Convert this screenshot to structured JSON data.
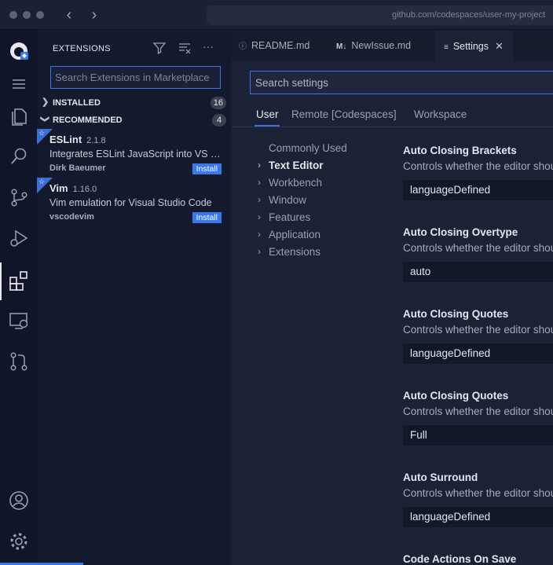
{
  "browser": {
    "url": "github.com/codespaces/user-my-project"
  },
  "activity_bar": {
    "items": [
      "accounts-icon",
      "menu-icon",
      "explorer-icon",
      "search-icon",
      "source-control-icon",
      "run-debug-icon",
      "extensions-icon",
      "remote-explorer-icon",
      "pull-requests-icon",
      "account-icon",
      "manage-gear-icon"
    ]
  },
  "sidebar": {
    "title": "EXTENSIONS",
    "search_placeholder": "Search Extensions in Marketplace",
    "sections": [
      {
        "label": "INSTALLED",
        "count": "16"
      },
      {
        "label": "RECOMMENDED",
        "count": "4"
      }
    ],
    "extensions": [
      {
        "name": "ESLint",
        "version": "2.1.8",
        "description": "Integrates ESLint JavaScript into VS Code.",
        "publisher": "Dirk Baeumer",
        "action": "Install"
      },
      {
        "name": "Vim",
        "version": "1.16.0",
        "description": "Vim emulation for Visual Studio Code",
        "publisher": "vscodevim",
        "action": "Install"
      }
    ]
  },
  "editor": {
    "tabs": [
      {
        "icon": "info-icon",
        "glyph": "ⓘ",
        "label": "README.md"
      },
      {
        "icon": "markdown-icon",
        "glyph": "M↓",
        "label": "NewIssue.md"
      },
      {
        "icon": "settings-list-icon",
        "glyph": "≡",
        "label": "Settings",
        "active": true
      }
    ],
    "settings": {
      "search_placeholder": "Search settings",
      "scopes": [
        "User",
        "Remote [Codespaces]",
        "Workspace"
      ],
      "active_scope": "User",
      "toc": [
        {
          "label": "Commonly Used",
          "expandable": false
        },
        {
          "label": "Text Editor",
          "expandable": true,
          "active": true
        },
        {
          "label": "Workbench",
          "expandable": true
        },
        {
          "label": "Window",
          "expandable": true
        },
        {
          "label": "Features",
          "expandable": true
        },
        {
          "label": "Application",
          "expandable": true
        },
        {
          "label": "Extensions",
          "expandable": true
        }
      ],
      "items": [
        {
          "title": "Auto Closing Brackets",
          "description": "Controls whether the editor should",
          "value": "languageDefined"
        },
        {
          "title": "Auto Closing Overtype",
          "description": "Controls whether the editor should",
          "value": "auto"
        },
        {
          "title": "Auto Closing Quotes",
          "description": "Controls whether the editor should",
          "value": "languageDefined"
        },
        {
          "title": "Auto Closing Quotes",
          "description": "Controls whether the editor should",
          "value": "Full"
        },
        {
          "title": "Auto Surround",
          "description": "Controls whether the editor should",
          "value": "languageDefined"
        },
        {
          "title": "Code Actions On Save",
          "description": "",
          "value": ""
        }
      ]
    }
  },
  "colors": {
    "accent": "#3a76e8",
    "background": "#141a2e",
    "editor_background": "#1c2236"
  }
}
